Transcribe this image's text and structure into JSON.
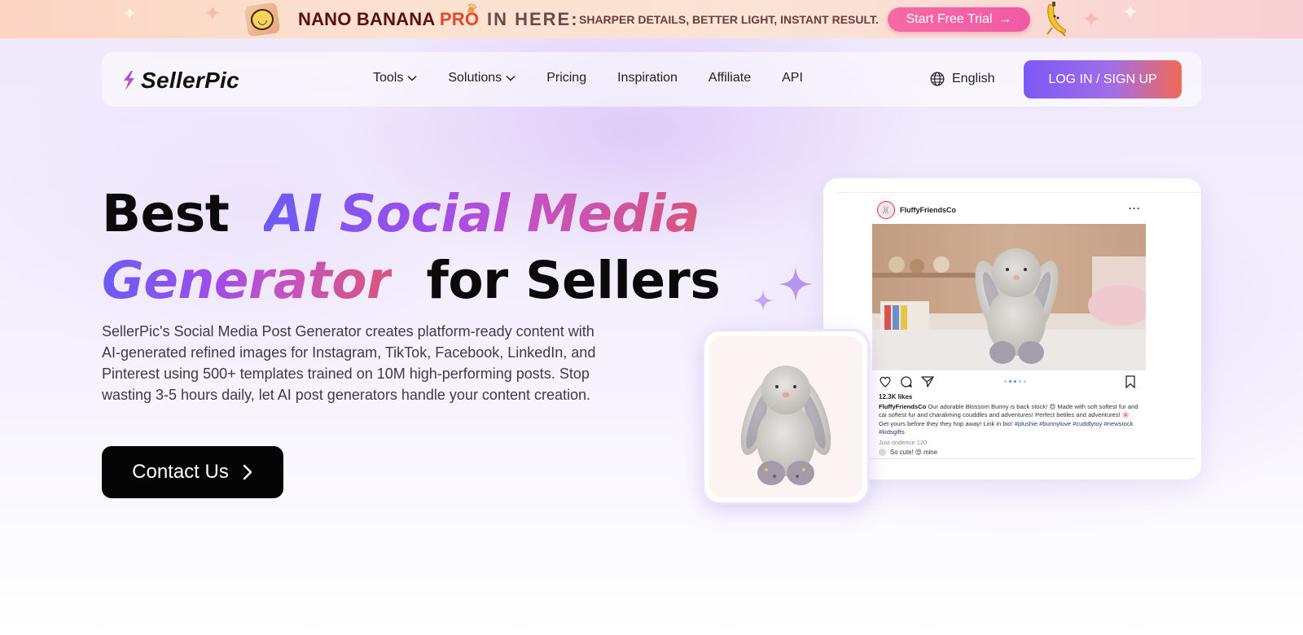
{
  "promo": {
    "brand_name": "NANO BANANA",
    "brand_suffix": "PRO",
    "in_here": "IN HERE:",
    "tagline": "SHARPER DETAILS, BETTER LIGHT, INSTANT RESULT.",
    "cta_label": "Start Free Trial"
  },
  "nav": {
    "brand": "SellerPic",
    "links": {
      "tools": "Tools",
      "solutions": "Solutions",
      "pricing": "Pricing",
      "inspiration": "Inspiration",
      "affiliate": "Affiliate",
      "api": "API"
    },
    "language": "English",
    "login_label": "LOG IN / SIGN UP"
  },
  "hero": {
    "title_1": "Best",
    "title_highlight_1": "AI Social Media",
    "title_highlight_2": "Generator",
    "title_2": "for Sellers",
    "description": "SellerPic's Social Media Post Generator creates platform-ready content with AI-generated refined images for Instagram, TikTok, Facebook, LinkedIn, and Pinterest using 500+ templates trained on 10M high-performing posts. Stop wasting 3-5 hours daily, let AI post generators handle your content creation.",
    "cta_label": "Contact Us"
  },
  "mockup": {
    "username": "FluffyFriendsCo",
    "likes": "12.3K likes",
    "caption_user": "FluffyFriendsCo",
    "caption_text": "Our adorable Blossom Bunny is back stock! 😍 Made with soft softest fur and cai softest fur and charaliming couddles and adventures! Perfect betiles and adventures! 🌸 Get yours before they they hop away! Link in bio!",
    "caption_tags": "#plushie #bunnylove #cuddlytoy #newstock #kidsgifts",
    "meta": "Just ondence     120",
    "comment": "So cute! 😍 mine"
  },
  "colors": {
    "accent_purple": "#7d58f5",
    "accent_coral": "#f06a55",
    "promo_pink": "#f76aa4",
    "headline_gradient_start": "#6b5cf4",
    "headline_gradient_end": "#d9557b"
  }
}
